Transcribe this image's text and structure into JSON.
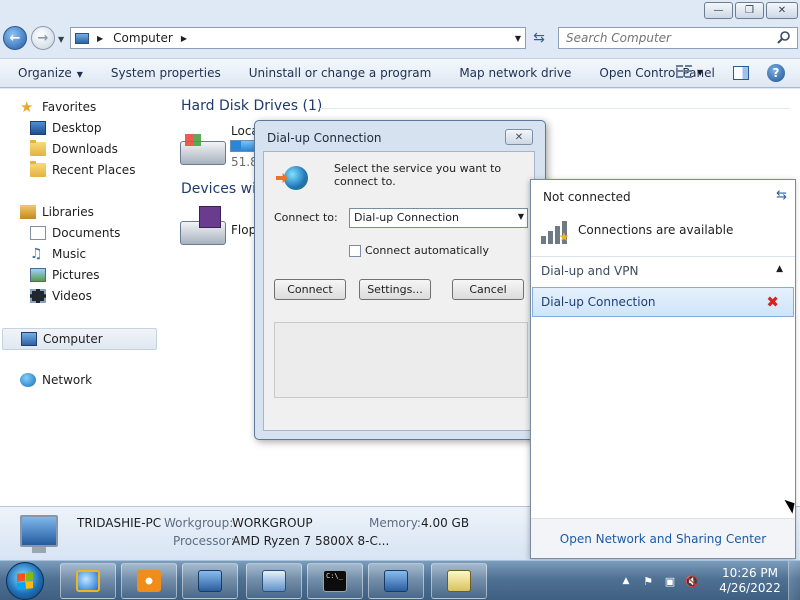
{
  "explorer": {
    "caption_buttons": {
      "minimize": "—",
      "maximize": "❐",
      "close": "✕"
    },
    "address": {
      "crumb": "Computer"
    },
    "search": {
      "placeholder": "Search Computer"
    },
    "toolbar": {
      "organize": "Organize",
      "system_properties": "System properties",
      "uninstall": "Uninstall or change a program",
      "map_drive": "Map network drive",
      "control_panel": "Open Control Panel",
      "help": "?"
    },
    "nav": {
      "favorites": "Favorites",
      "desktop": "Desktop",
      "downloads": "Downloads",
      "recent": "Recent Places",
      "libraries": "Libraries",
      "documents": "Documents",
      "music": "Music",
      "pictures": "Pictures",
      "videos": "Videos",
      "computer": "Computer",
      "network": "Network"
    },
    "content": {
      "hdd_header": "Hard Disk Drives (1)",
      "local_disk_label": "Loca",
      "local_disk_free": "51.8",
      "local_disk_fill_fraction": 0.35,
      "devices_header": "Devices wit",
      "floppy_label": "Flop"
    },
    "details": {
      "pc_name": "TRIDASHIE-PC",
      "workgroup_key": "Workgroup:",
      "workgroup_val": "WORKGROUP",
      "memory_key": "Memory:",
      "memory_val": "4.00 GB",
      "processor_key": "Processor:",
      "processor_val": "AMD Ryzen 7 5800X 8-C..."
    }
  },
  "dialog": {
    "title": "Dial-up Connection",
    "close": "✕",
    "instruction": "Select the service you want to connect to.",
    "connect_to_label": "Connect to:",
    "connect_to_value": "Dial-up Connection",
    "auto_connect_label": "Connect automatically",
    "buttons": {
      "connect": "Connect",
      "settings": "Settings...",
      "cancel": "Cancel"
    }
  },
  "flyout": {
    "status": "Not connected",
    "available": "Connections are available",
    "group": "Dial-up and VPN",
    "connection": "Dial-up Connection",
    "footer_link": "Open Network and Sharing Center"
  },
  "taskbar": {
    "tray_up": "▲",
    "clock_time": "10:26 PM",
    "clock_date": "4/26/2022"
  },
  "colors": {
    "accent": "#1b5aa6",
    "selection": "#cfe4fa",
    "error_x": "#d7231f",
    "taskbar": "#4f7193"
  }
}
